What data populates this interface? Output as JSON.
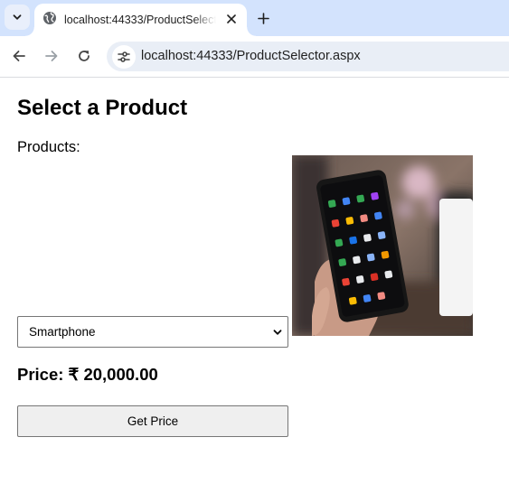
{
  "browser": {
    "tab": {
      "title": "localhost:44333/ProductSelector.aspx",
      "favicon": "globe-icon"
    },
    "address_bar": {
      "url": "localhost:44333/ProductSelector.aspx"
    },
    "icons": {
      "tab_search": "chevron-down-icon",
      "close_tab": "close-icon",
      "new_tab": "plus-icon",
      "back": "back-arrow-icon",
      "forward": "forward-arrow-icon",
      "reload": "reload-icon",
      "site_info": "tune-icon"
    },
    "colors": {
      "tabstrip": "#d3e3fd",
      "omnibox": "#e9eef6"
    }
  },
  "page": {
    "title": "Select a Product",
    "products_label": "Products:",
    "product_image": "smartphone-photo",
    "product_select": {
      "selected": "Smartphone"
    },
    "price_text": "Price: ₹ 20,000.00",
    "get_price_label": "Get Price"
  }
}
